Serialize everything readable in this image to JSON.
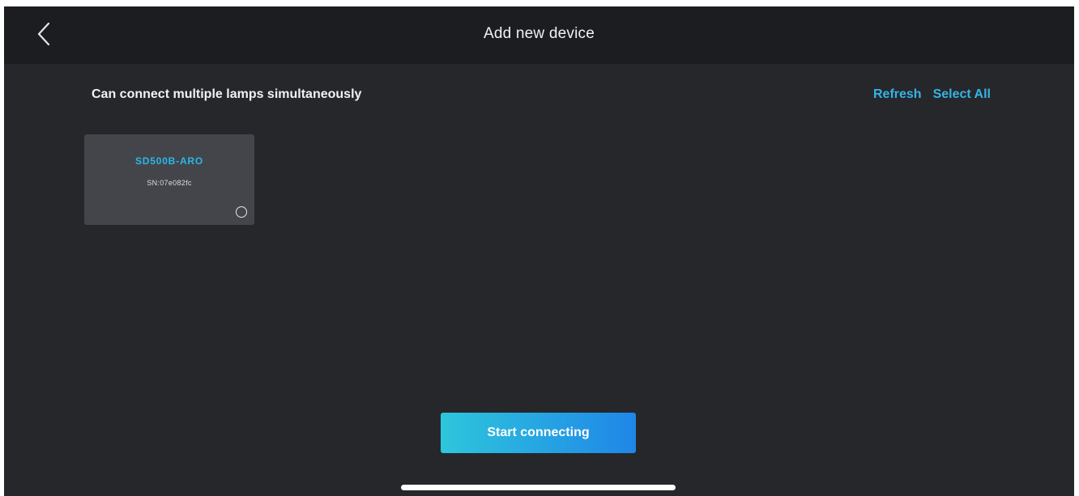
{
  "header": {
    "title": "Add new device",
    "back_icon": "chevron-left-icon"
  },
  "main": {
    "subtitle": "Can connect multiple lamps simultaneously",
    "actions": {
      "refresh_label": "Refresh",
      "select_all_label": "Select All"
    },
    "devices": [
      {
        "name": "SD500B-ARO",
        "sn": "SN:07e082fc",
        "selected": false
      }
    ],
    "start_button_label": "Start connecting"
  },
  "colors": {
    "background": "#26272b",
    "header_background": "#1c1d20",
    "accent": "#34b4e4",
    "card_background": "#43454b",
    "button_gradient_start": "#2ec6dc",
    "button_gradient_end": "#1f86e8"
  }
}
